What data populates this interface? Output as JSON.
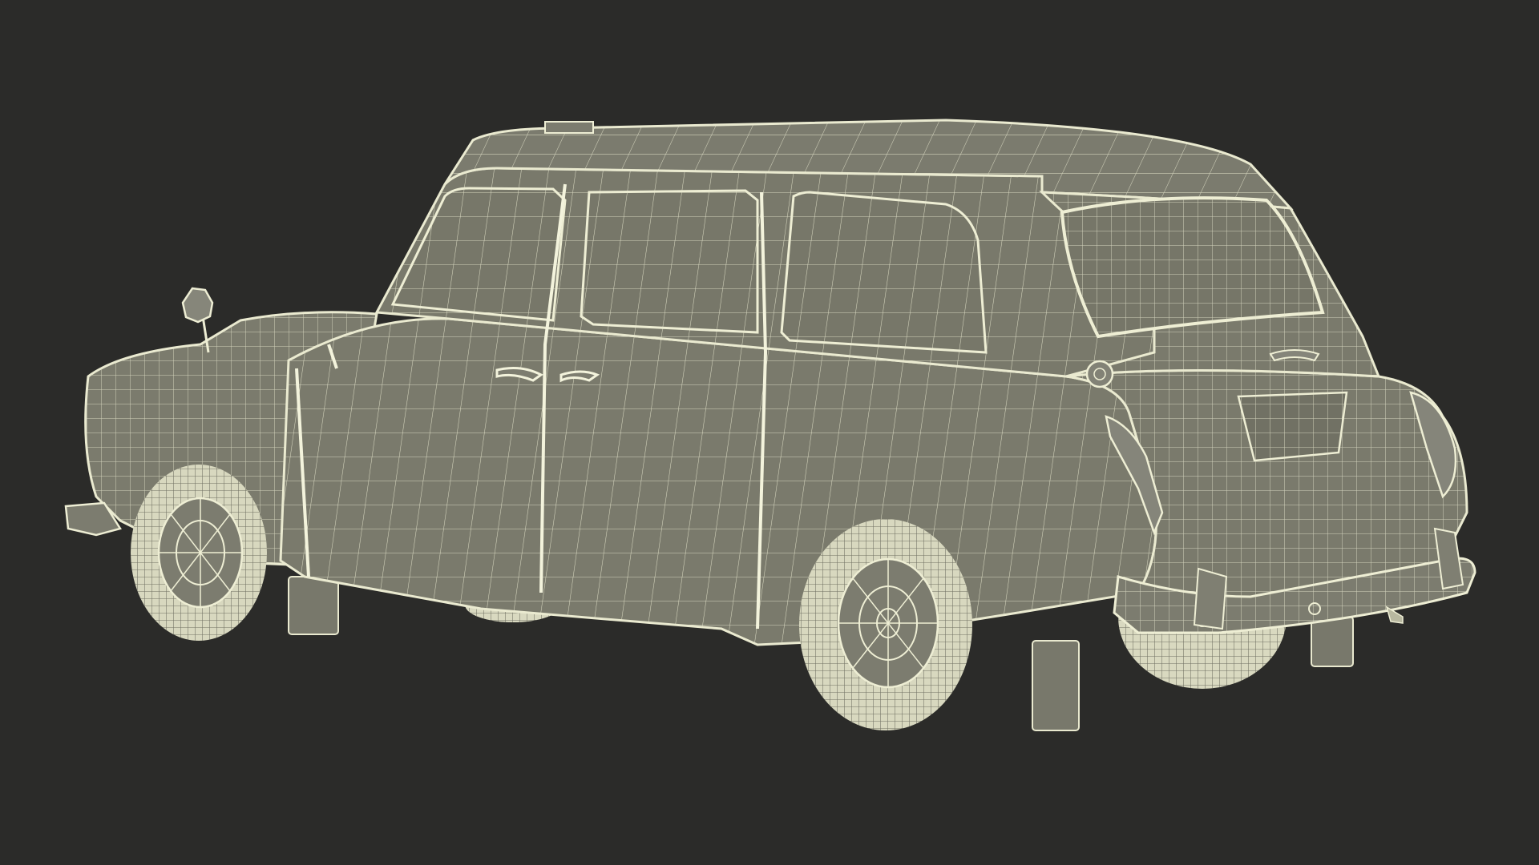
{
  "scene": {
    "subject": "wireframe-car-render",
    "colors": {
      "background": "#2b2b29",
      "body_fill": "#7a7a6c",
      "body_fill_dark": "#6d6d60",
      "glass_fill": "#75756a",
      "wire": "#e9e9cf",
      "wire_dense": "#f1f1dc",
      "tire_fill": "#d8d8bf",
      "shadow_fill": "#5e5e53"
    }
  }
}
